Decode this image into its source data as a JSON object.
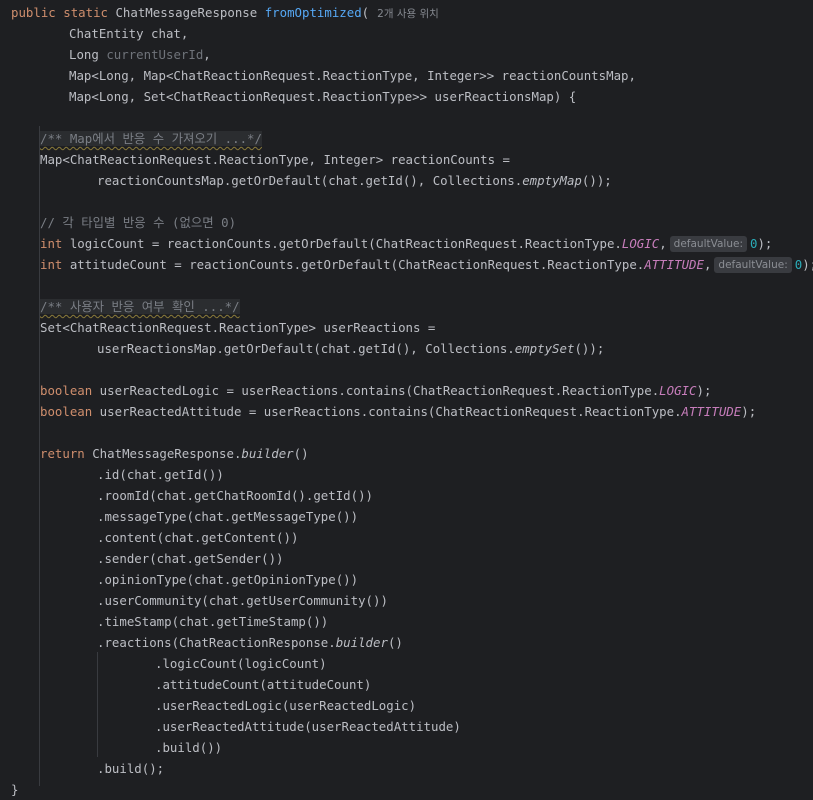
{
  "usage_hint": "2개 사용 위치",
  "code": {
    "l1": {
      "kw_public": "public",
      "kw_static": "static",
      "ret_type": "ChatMessageResponse",
      "method": "fromOptimized",
      "paren": "("
    },
    "l2": {
      "decl": "ChatEntity chat,"
    },
    "l3": {
      "type": "Long ",
      "param": "currentUserId",
      "rest": ","
    },
    "l4": {
      "decl": "Map<Long, Map<ChatReactionRequest.ReactionType, Integer>> reactionCountsMap,"
    },
    "l5": {
      "decl": "Map<Long, Set<ChatReactionRequest.ReactionType>> userReactionsMap) {"
    },
    "l7": {
      "comment": "/** Map에서 반응 수 가져오기 ...*/"
    },
    "l8": {
      "text": "Map<ChatReactionRequest.ReactionType, Integer> reactionCounts ="
    },
    "l9": {
      "pre": "reactionCountsMap.getOrDefault(chat.getId(), Collections.",
      "call": "emptyMap",
      "post": "());"
    },
    "l11": {
      "comment": "// 각 타입별 반응 수 (없으면 0)"
    },
    "l12": {
      "kw": "int",
      "pre": " logicCount = reactionCounts.getOrDefault(ChatReactionRequest.ReactionType.",
      "const": "LOGIC",
      "comma": ",",
      "hint": "defaultValue:",
      "num": "0",
      "post": ");"
    },
    "l13": {
      "kw": "int",
      "pre": " attitudeCount = reactionCounts.getOrDefault(ChatReactionRequest.ReactionType.",
      "const": "ATTITUDE",
      "comma": ",",
      "hint": "defaultValue:",
      "num": "0",
      "post": ");"
    },
    "l15": {
      "comment": "/** 사용자 반응 여부 확인 ...*/"
    },
    "l16": {
      "text": "Set<ChatReactionRequest.ReactionType> userReactions ="
    },
    "l17": {
      "pre": "userReactionsMap.getOrDefault(chat.getId(), Collections.",
      "call": "emptySet",
      "post": "());"
    },
    "l19": {
      "kw": "boolean",
      "pre": " userReactedLogic = userReactions.contains(ChatReactionRequest.ReactionType.",
      "const": "LOGIC",
      "post": ");"
    },
    "l20": {
      "kw": "boolean",
      "pre": " userReactedAttitude = userReactions.contains(ChatReactionRequest.ReactionType.",
      "const": "ATTITUDE",
      "post": ");"
    },
    "l22": {
      "kw": "return",
      "pre": " ChatMessageResponse.",
      "call": "builder",
      "post": "()"
    },
    "l23": {
      "text": ".id(chat.getId())"
    },
    "l24": {
      "text": ".roomId(chat.getChatRoomId().getId())"
    },
    "l25": {
      "text": ".messageType(chat.getMessageType())"
    },
    "l26": {
      "text": ".content(chat.getContent())"
    },
    "l27": {
      "text": ".sender(chat.getSender())"
    },
    "l28": {
      "text": ".opinionType(chat.getOpinionType())"
    },
    "l29": {
      "text": ".userCommunity(chat.getUserCommunity())"
    },
    "l30": {
      "text": ".timeStamp(chat.getTimeStamp())"
    },
    "l31": {
      "pre": ".reactions(ChatReactionResponse.",
      "call": "builder",
      "post": "()"
    },
    "l32": {
      "text": ".logicCount(logicCount)"
    },
    "l33": {
      "text": ".attitudeCount(attitudeCount)"
    },
    "l34": {
      "text": ".userReactedLogic(userReactedLogic)"
    },
    "l35": {
      "text": ".userReactedAttitude(userReactedAttitude)"
    },
    "l36": {
      "text": ".build())"
    },
    "l37": {
      "text": ".build();"
    },
    "l38": {
      "text": "}"
    }
  },
  "colors": {
    "background": "#1e1f22",
    "keyword": "#cf8e6d",
    "method_decl": "#56a8f5",
    "constant": "#c77dbb",
    "number": "#2aacb8",
    "comment": "#7a7e85",
    "default_text": "#bcbec4"
  }
}
